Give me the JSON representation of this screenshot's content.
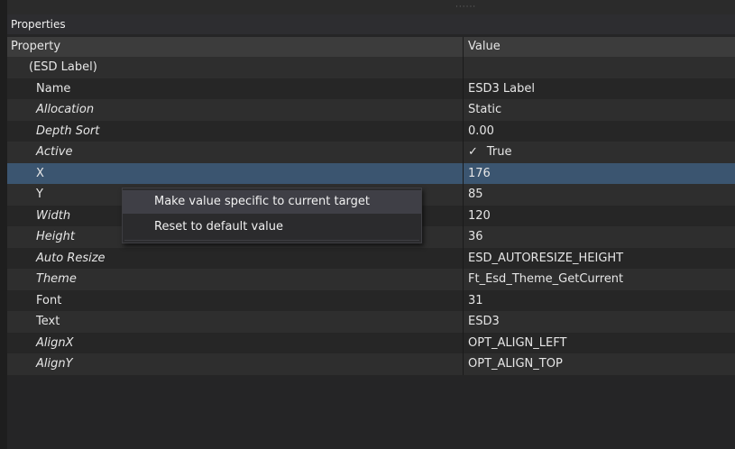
{
  "panel": {
    "title": "Properties"
  },
  "table": {
    "col_property": "Property",
    "col_value": "Value",
    "rows": [
      {
        "name": "(ESD Label)",
        "value": "",
        "italic": false,
        "selected": false
      },
      {
        "name": "Name",
        "value": "ESD3 Label",
        "italic": false,
        "selected": false
      },
      {
        "name": "Allocation",
        "value": "Static",
        "italic": true,
        "selected": false
      },
      {
        "name": "Depth Sort",
        "value": "0.00",
        "italic": true,
        "selected": false
      },
      {
        "name": "Active",
        "value": "True",
        "check": "✓",
        "italic": true,
        "selected": false
      },
      {
        "name": "X",
        "value": "176",
        "italic": false,
        "selected": true
      },
      {
        "name": "Y",
        "value": "85",
        "italic": false,
        "selected": false
      },
      {
        "name": "Width",
        "value": "120",
        "italic": true,
        "selected": false
      },
      {
        "name": "Height",
        "value": "36",
        "italic": true,
        "selected": false
      },
      {
        "name": "Auto Resize",
        "value": "ESD_AUTORESIZE_HEIGHT",
        "italic": true,
        "selected": false
      },
      {
        "name": "Theme",
        "value": "Ft_Esd_Theme_GetCurrent",
        "italic": true,
        "selected": false
      },
      {
        "name": "Font",
        "value": "31",
        "italic": false,
        "selected": false
      },
      {
        "name": "Text",
        "value": "ESD3",
        "italic": false,
        "selected": false
      },
      {
        "name": "AlignX",
        "value": "OPT_ALIGN_LEFT",
        "italic": true,
        "selected": false
      },
      {
        "name": "AlignY",
        "value": "OPT_ALIGN_TOP",
        "italic": true,
        "selected": false
      }
    ]
  },
  "context_menu": {
    "items": [
      {
        "label": "Make value specific to current target"
      },
      {
        "label": "Reset to default value"
      }
    ]
  },
  "colors": {
    "background": "#252526",
    "selected_row": "#3b5570",
    "menu_highlight": "#3f3f46"
  }
}
